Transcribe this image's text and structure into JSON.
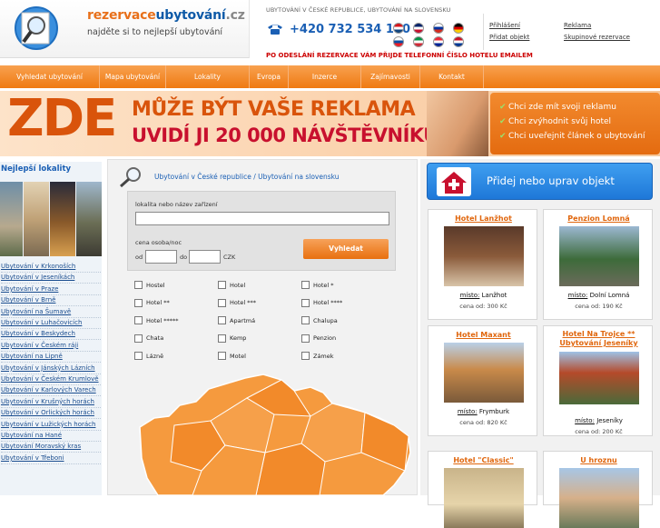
{
  "header": {
    "logo_prefix": "rezervace",
    "logo_middle": "ubytování",
    "logo_suffix": ".cz",
    "slogan": "najděte si to nejlepší ubytování",
    "caption": "UBYTOVÁNÍ V ČESKÉ REPUBLICE, UBYTOVÁNÍ NA SLOVENSKU",
    "phone": "+420 732 534 150",
    "notice": "PO ODESLÁNÍ REZERVACE VÁM PŘIJDE TELEFONNÍ ČÍSLO HOTELU EMAILEM",
    "quick_links": [
      "Přihlášení",
      "Reklama",
      "Přidat objekt",
      "Skupinové rezervace"
    ],
    "flag_colors": [
      [
        "#d7141a",
        "#ffffff",
        "#11457e"
      ],
      [
        "#012169",
        "#ffffff",
        "#c8102e"
      ],
      [
        "#ffffff",
        "#0033a0",
        "#d52b1e"
      ],
      [
        "#000000",
        "#dd0000",
        "#ffce00"
      ],
      [
        "#ffffff",
        "#0b4ea2",
        "#ee1c25"
      ],
      [
        "#009246",
        "#ffffff",
        "#ce2b37"
      ],
      [
        "#ed2939",
        "#ffffff",
        "#002395"
      ],
      [
        "#ce1126",
        "#ffffff",
        "#003893"
      ]
    ]
  },
  "nav": [
    "Vyhledat ubytování",
    "Mapa ubytování",
    "Lokality",
    "Evropa",
    "Inzerce",
    "Zajímavosti",
    "Kontakt"
  ],
  "banner": {
    "big": "ZDE",
    "line1": "MŮŽE BÝT VAŠE REKLAMA",
    "line2": "UVIDÍ JI 20 000 NÁVŠTĚVNÍKŮ",
    "points": [
      "Chci zde mít svoji reklamu",
      "Chci zvýhodnit svůj hotel",
      "Chci uveřejnit článek o ubytování"
    ],
    "check_glyph": "✔"
  },
  "sidebar": {
    "title": "Nejlepší lokality",
    "links": [
      "Ubytování v Krkonoších",
      "Ubytování v Jeseníkách",
      "Ubytování v Praze",
      "Ubytování v Brně",
      "Ubytování na Šumavě",
      "Ubytování v Luhačovicích",
      "Ubytování v Beskydech",
      "Ubytování v Českém ráji",
      "Ubytování na Lipně",
      "Ubytování v Jánských Lázních",
      "Ubytování v Českém Krumlově",
      "Ubytování v Karlových Varech",
      "Ubytování v Krušných horách",
      "Ubytování v Orlických horách",
      "Ubytování v Lužických horách",
      "Ubytování na Hané",
      "Ubytování Moravský kras",
      "Ubytování v Třeboni"
    ]
  },
  "search": {
    "breadcrumb": "Ubytování v České republice / Ubytování na slovensku",
    "location_label": "lokalita nebo název zařízení",
    "location_value": "",
    "price_label": "cena osoba/noc",
    "from_label": "od",
    "from_value": "",
    "to_label": "do",
    "to_value": "",
    "currency": "CZK",
    "button": "Vyhledat",
    "types": [
      "Hostel",
      "Hotel",
      "Hotel *",
      "Hotel **",
      "Hotel ***",
      "Hotel ****",
      "Hotel *****",
      "Apartmá",
      "Chalupa",
      "Chata",
      "Kemp",
      "Penzion",
      "Lázně",
      "Motel",
      "Zámek"
    ]
  },
  "right": {
    "add_button": "Přidej nebo uprav objekt",
    "place_key": "místo:",
    "price_key": "cena od:",
    "cards": [
      {
        "name": "Hotel Lanžhot",
        "place": "Lanžhot",
        "price": "300 Kč"
      },
      {
        "name": "Penzion Lomná",
        "place": "Dolní Lomná",
        "price": "190 Kč"
      },
      {
        "name": "Hotel Maxant",
        "place": "Frymburk",
        "price": "820 Kč"
      },
      {
        "name": "Hotel Na Trojce ** Ubytování Jeseníky",
        "place": "Jeseníky",
        "price": "200 Kč"
      },
      {
        "name": "Hotel \"Classic\"",
        "place": "",
        "price": ""
      },
      {
        "name": "U hroznu",
        "place": "",
        "price": ""
      }
    ]
  }
}
